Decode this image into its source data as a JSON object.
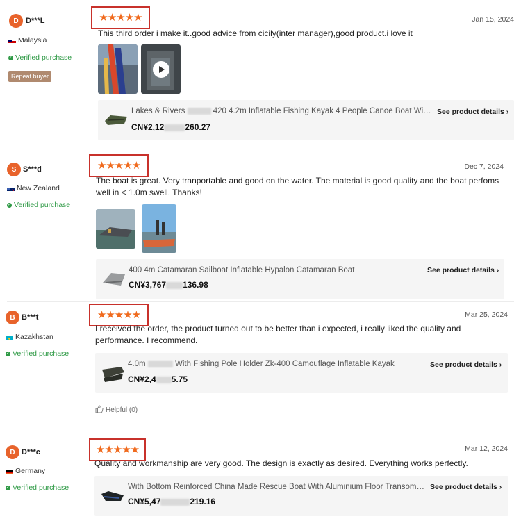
{
  "reviews": [
    {
      "avatar_initial": "D",
      "username": "D***L",
      "country": "Malaysia",
      "verified_label": "Verified purchase",
      "badge": "Repeat buyer",
      "stars": "★★★★★",
      "rating": 5,
      "date": "Jan 15, 2024",
      "text": "This third order i make it..good advice from cicily(inter manager),good product.i love it",
      "product_name": "Lakes & Rivers 420 4.2m Inflatable Fishing Kayak 4 People Canoe Boat With M...",
      "product_name_a": "Lakes & Rivers",
      "product_name_b": "420 4.2m Inflatable Fishing Kayak 4 People Canoe Boat With M...",
      "price_a": "CN¥2,12",
      "price_b": "260.27",
      "see_details": "See product details"
    },
    {
      "avatar_initial": "S",
      "username": "S***d",
      "country": "New Zealand",
      "verified_label": "Verified purchase",
      "stars": "★★★★★",
      "rating": 5,
      "date": "Dec 7, 2024",
      "text": "The boat is great. Very tranportable and good on the water. The material is good quality and the boat perfoms well in < 1.0m swell. Thanks!",
      "product_name": "400 4m Catamaran Sailboat Inflatable Hypalon Catamaran Boat",
      "price_a": "CN¥3,767",
      "price_b": "136.98",
      "see_details": "See product details"
    },
    {
      "avatar_initial": "B",
      "username": "B***t",
      "country": "Kazakhstan",
      "verified_label": "Verified purchase",
      "stars": "★★★★★",
      "rating": 5,
      "date": "Mar 25, 2024",
      "text": "I received the order, the product turned out to be better than i expected, i really liked the quality and performance. I recommend.",
      "product_name_a": "4.0m",
      "product_name_b": "With Fishing Pole Holder Zk-400 Camouflage Inflatable Kayak",
      "price_a": "CN¥2,4",
      "price_b": "5.75",
      "see_details": "See product details",
      "helpful": "Helpful (0)"
    },
    {
      "avatar_initial": "D",
      "username": "D***c",
      "country": "Germany",
      "verified_label": "Verified purchase",
      "stars": "★★★★★",
      "rating": 5,
      "date": "Mar 12, 2024",
      "text": "Quality and workmanship are very good. The design is exactly as desired. Everything works perfectly.",
      "product_name": "With Bottom Reinforced China Made Rescue Boat With Aluminium Floor Transom Ga...",
      "price_a": "CN¥5,47",
      "price_b": "219.16",
      "see_details": "See product details"
    }
  ],
  "colors": {
    "accent_orange": "#e8632b",
    "star_color": "#f06a1d",
    "highlight_box": "#c8312b",
    "verified_green": "#2f9a46",
    "badge_brown": "#b08a6f",
    "card_bg": "#f5f5f5"
  },
  "icons": {
    "chevron": "›",
    "thumbs_up": "thumbs-up-icon",
    "play": "play-icon",
    "check": "✓"
  }
}
